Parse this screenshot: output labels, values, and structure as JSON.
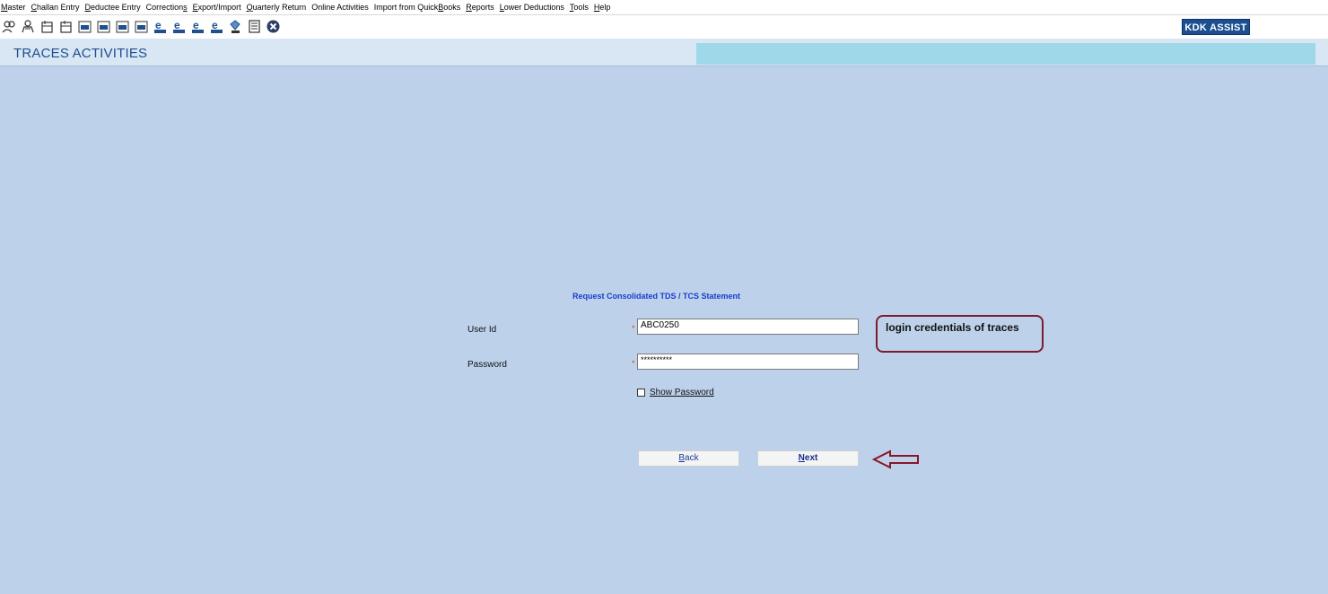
{
  "menu": [
    {
      "label": "Master",
      "ul": "M",
      "rest": "aster"
    },
    {
      "label": "Challan Entry",
      "ul": "C",
      "rest": "hallan Entry"
    },
    {
      "label": "Deductee Entry",
      "ul": "D",
      "rest": "eductee Entry"
    },
    {
      "label": "Corrections",
      "pre": "Correction",
      "ul": "s",
      "rest": ""
    },
    {
      "label": "Export/Import",
      "ul": "E",
      "rest": "xport/Import"
    },
    {
      "label": "Quarterly Return",
      "ul": "Q",
      "rest": "uarterly Return"
    },
    {
      "label": "Online Activities",
      "ul": "",
      "rest": "Online Activities"
    },
    {
      "label": "Import from QuickBooks",
      "pre": "Import from Quick",
      "ul": "B",
      "rest": "ooks"
    },
    {
      "label": "Reports",
      "ul": "R",
      "rest": "eports"
    },
    {
      "label": "Lower Deductions",
      "ul": "L",
      "rest": "ower Deductions"
    },
    {
      "label": "Tools",
      "ul": "T",
      "rest": "ools"
    },
    {
      "label": "Help",
      "ul": "H",
      "rest": "elp"
    }
  ],
  "toolbar": {
    "icons": [
      "users-icon",
      "group-icon",
      "form-icon",
      "form2-icon",
      "tds-form-24q-icon",
      "tds-form-26q-icon",
      "tds-form-27q-icon",
      "tds-form-27eq-icon",
      "e-24q-icon",
      "e-26q-icon",
      "e-27q-icon",
      "e-27eq-icon",
      "tds-gem-icon",
      "document-icon",
      "close-circle-icon"
    ],
    "assist_label": "KDK ASSIST"
  },
  "header": {
    "title": "TRACES ACTIVITIES"
  },
  "form": {
    "title": "Request Consolidated TDS / TCS Statement",
    "user_id_label": "User Id",
    "user_id_value": "ABC0250",
    "password_label": "Password",
    "password_value": "**********",
    "required_mark": "*",
    "show_password_label": "Show Password",
    "back_ul": "B",
    "back_rest": "ack",
    "next_ul": "N",
    "next_rest": "ext"
  },
  "annotation": {
    "callout_text": "login credentials of traces"
  },
  "colors": {
    "background": "#bdd2ea",
    "title_blue": "#1d4f91",
    "kdk_blue": "#1b4f8f",
    "callout_border": "#7e1a2a"
  }
}
